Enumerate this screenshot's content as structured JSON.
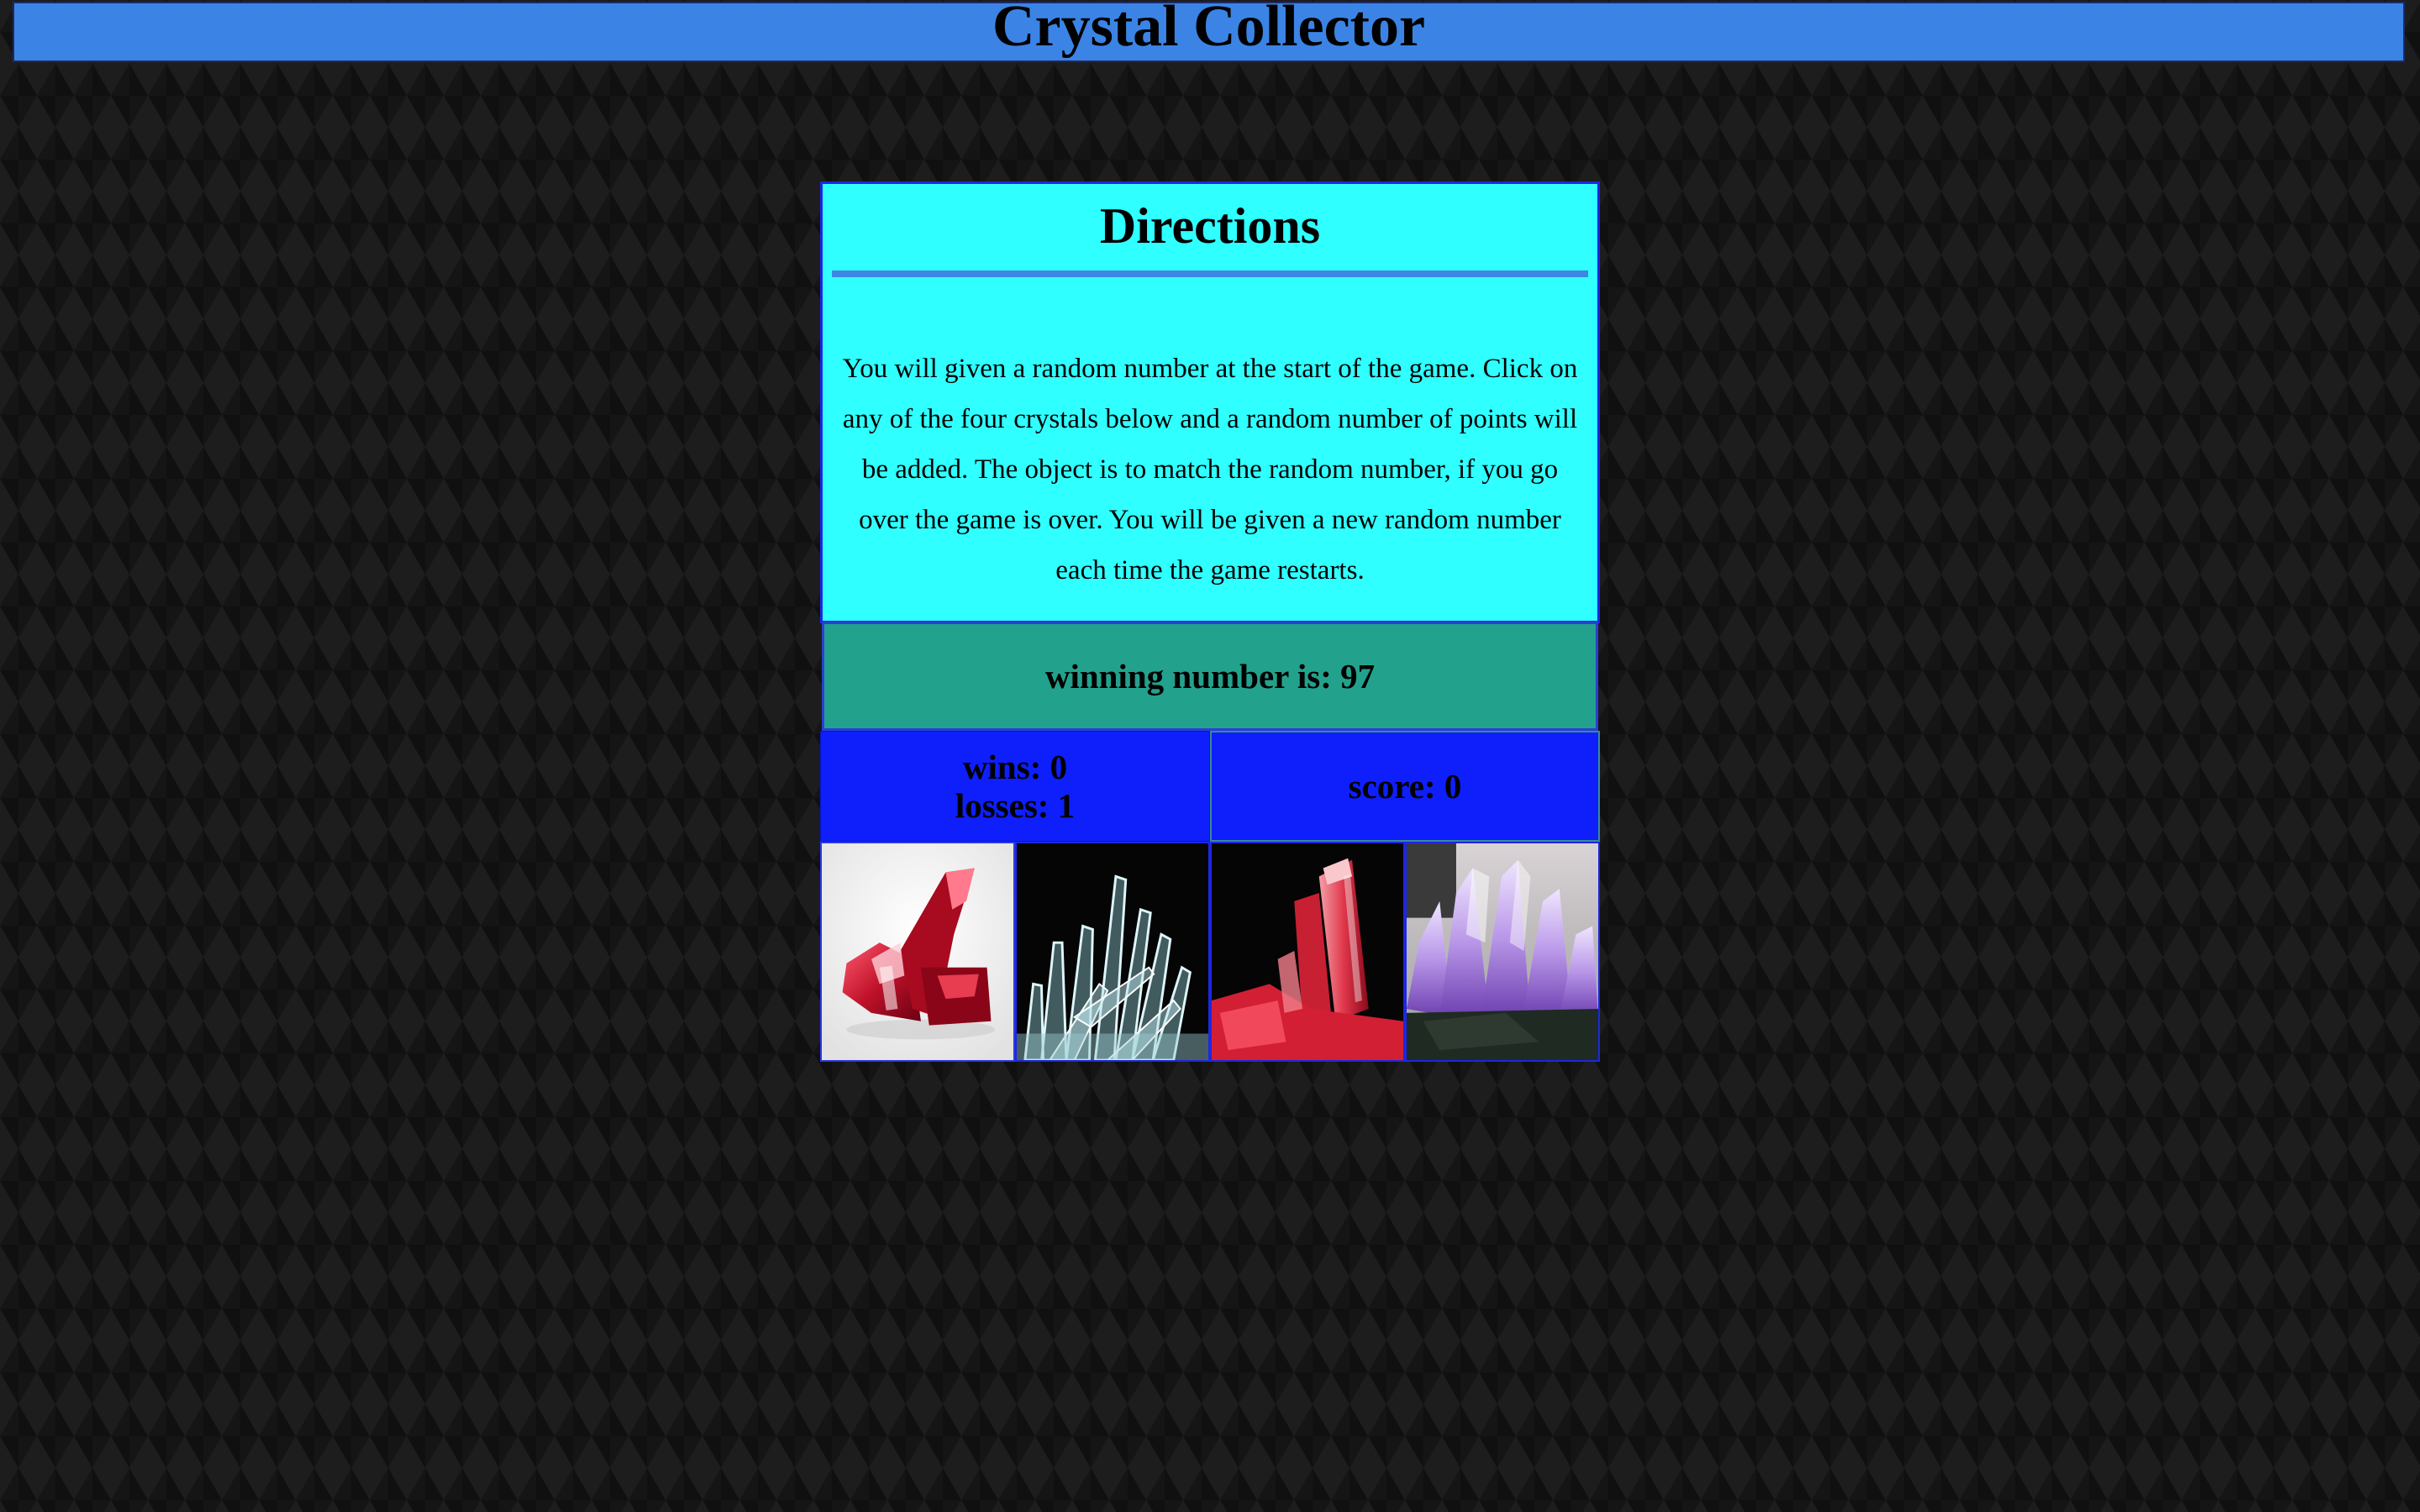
{
  "app": {
    "title": "Crystal Collector"
  },
  "directions": {
    "heading": "Directions",
    "text": "You will given a random number at the start of the game. Click on any of the four crystals below and a random number of points will be added. The object is to match the random number, if you go over the game is over. You will be given a new random number each time the game restarts."
  },
  "winning": {
    "text": "winning number is: 97"
  },
  "stats": {
    "wins": "wins: 0",
    "losses": "losses: 1",
    "score": "score: 0"
  },
  "crystals": [
    {
      "name": "red-crystal-icon",
      "color": "#c0122a"
    },
    {
      "name": "clear-crystal-icon",
      "color": "#9fd4dc"
    },
    {
      "name": "pink-crystal-icon",
      "color": "#e0364a"
    },
    {
      "name": "purple-crystal-icon",
      "color": "#9a6bd0"
    }
  ],
  "colors": {
    "header_bg": "#3b84e5",
    "directions_bg": "#30ffff",
    "winning_bg": "#22a28d",
    "stats_bg": "#0e1ffc"
  }
}
